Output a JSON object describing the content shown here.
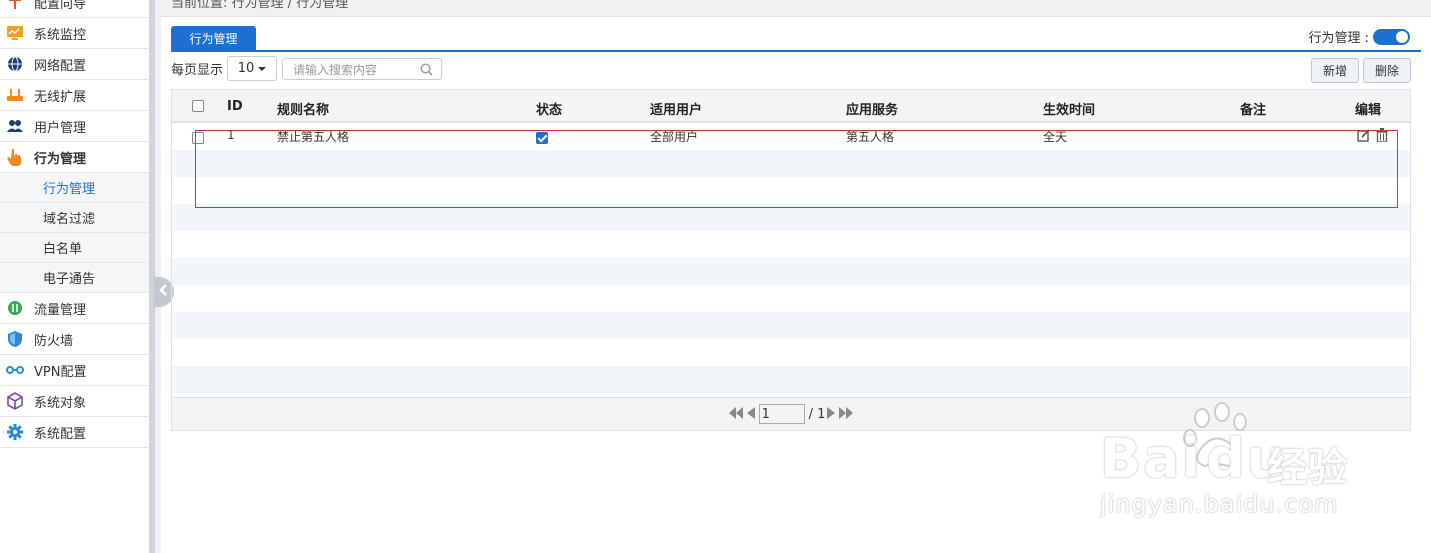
{
  "breadcrumb": "当前位置: 行为管理  /  行为管理",
  "sidebar": {
    "items": [
      {
        "label": "配置向导",
        "icon": "pin-icon",
        "color": "#e8562a"
      },
      {
        "label": "系统监控",
        "icon": "monitor-icon",
        "color": "#f0a020"
      },
      {
        "label": "网络配置",
        "icon": "globe-icon",
        "color": "#1f3e7a"
      },
      {
        "label": "无线扩展",
        "icon": "router-icon",
        "color": "#f08a20"
      },
      {
        "label": "用户管理",
        "icon": "users-icon",
        "color": "#1f3e7a"
      },
      {
        "label": "行为管理",
        "icon": "hand-pointer-icon",
        "color": "#f08a20"
      }
    ],
    "sub_items": [
      {
        "label": "行为管理",
        "active": true
      },
      {
        "label": "域名过滤",
        "active": false
      },
      {
        "label": "白名单",
        "active": false
      },
      {
        "label": "电子通告",
        "active": false
      }
    ],
    "items_after": [
      {
        "label": "流量管理",
        "icon": "traffic-icon",
        "color": "#3aa85a"
      },
      {
        "label": "防火墙",
        "icon": "shield-icon",
        "color": "#2a8ad8"
      },
      {
        "label": "VPN配置",
        "icon": "vpn-icon",
        "color": "#2a8ad8"
      },
      {
        "label": "系统对象",
        "icon": "cube-icon",
        "color": "#7a4ab8"
      },
      {
        "label": "系统配置",
        "icon": "gear-icon",
        "color": "#2a8ad8"
      }
    ]
  },
  "tab": {
    "label": "行为管理"
  },
  "toggle": {
    "label": "行为管理 :",
    "on": true
  },
  "toolbar": {
    "page_size_label": "每页显示",
    "page_size_value": "10",
    "search_placeholder": "请输入搜索内容",
    "add_label": "新增",
    "delete_label": "删除"
  },
  "table": {
    "headers": [
      "ID",
      "规则名称",
      "状态",
      "适用用户",
      "应用服务",
      "生效时间",
      "备注",
      "编辑"
    ],
    "rows": [
      {
        "id": "1",
        "name": "禁止第五人格",
        "status": true,
        "users": "全部用户",
        "service": "第五人格",
        "time": "全天",
        "note": ""
      }
    ]
  },
  "pager": {
    "current": "1",
    "total": "/ 1"
  },
  "watermark": {
    "brand": "Bai",
    "brand2": "du",
    "cn": "经验",
    "url": "jingyan.baidu.com"
  },
  "colors": {
    "accent": "#1e6fd2",
    "highlight": "#d0343a"
  }
}
